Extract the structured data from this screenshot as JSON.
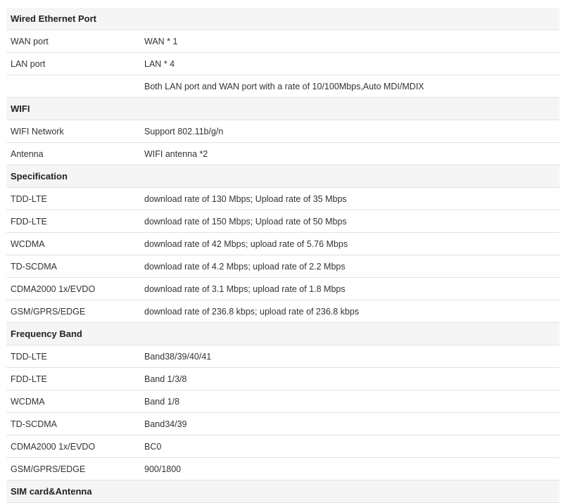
{
  "sections": [
    {
      "title": "Wired Ethernet Port",
      "rows": [
        {
          "label": "WAN port",
          "value": "WAN * 1"
        },
        {
          "label": "LAN port",
          "value": "LAN * 4"
        },
        {
          "label": "",
          "value": "Both LAN port and WAN port with a rate of 10/100Mbps,Auto MDI/MDIX"
        }
      ]
    },
    {
      "title": "WIFI",
      "rows": [
        {
          "label": "WIFI Network",
          "value": "Support 802.11b/g/n"
        },
        {
          "label": "Antenna",
          "value": "WIFI antenna *2"
        }
      ]
    },
    {
      "title": "Specification",
      "rows": [
        {
          "label": "TDD-LTE",
          "value": "download rate of 130 Mbps; Upload rate of 35 Mbps"
        },
        {
          "label": "FDD-LTE",
          "value": "download rate of 150 Mbps; Upload rate of 50 Mbps"
        },
        {
          "label": "WCDMA",
          "value": "download rate of 42 Mbps; upload rate of 5.76 Mbps"
        },
        {
          "label": "TD-SCDMA",
          "value": "download rate of 4.2 Mbps; upload rate of 2.2 Mbps"
        },
        {
          "label": "CDMA2000 1x/EVDO",
          "value": "download rate of 3.1 Mbps; upload rate of 1.8 Mbps"
        },
        {
          "label": "GSM/GPRS/EDGE",
          "value": "download rate of 236.8 kbps; upload rate of 236.8 kbps"
        }
      ]
    },
    {
      "title": "Frequency Band",
      "rows": [
        {
          "label": "TDD-LTE",
          "value": "Band38/39/40/41"
        },
        {
          "label": "FDD-LTE",
          "value": "Band 1/3/8"
        },
        {
          "label": "WCDMA",
          "value": "Band 1/8"
        },
        {
          "label": "TD-SCDMA",
          "value": "Band34/39"
        },
        {
          "label": "CDMA2000 1x/EVDO",
          "value": "BC0"
        },
        {
          "label": "GSM/GPRS/EDGE",
          "value": "900/1800"
        }
      ]
    },
    {
      "title": "SIM card&Antenna",
      "rows": []
    }
  ]
}
